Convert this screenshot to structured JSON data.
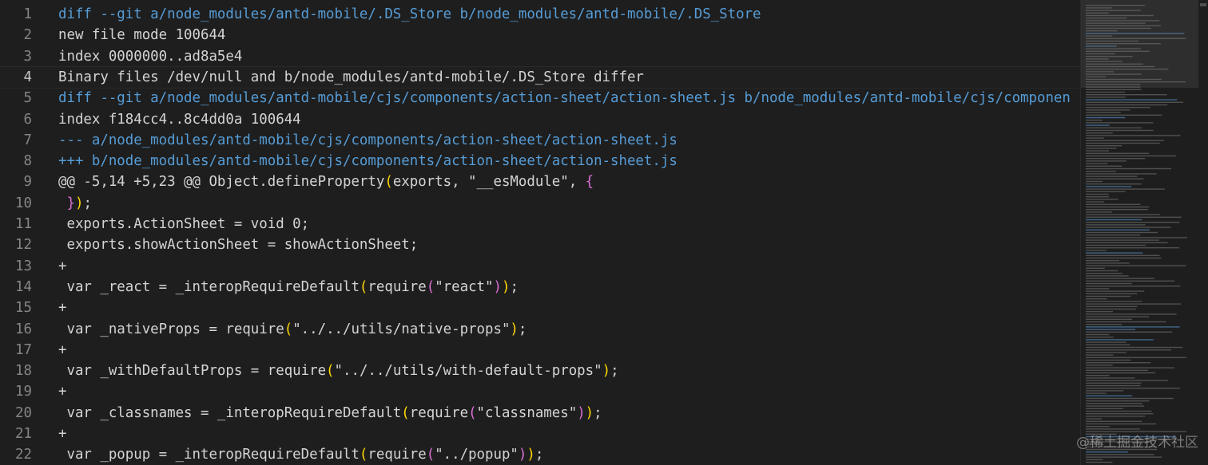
{
  "lines": [
    {
      "num": "1",
      "tokens": [
        {
          "t": "diff --git a/node_modules/antd-mobile/.DS_Store b/node_modules/antd-mobile/.DS_Store",
          "c": "meta"
        }
      ]
    },
    {
      "num": "2",
      "tokens": [
        {
          "t": "new file mode 100644",
          "c": "plain"
        }
      ]
    },
    {
      "num": "3",
      "tokens": [
        {
          "t": "index 0000000..ad8a5e4",
          "c": "plain"
        }
      ]
    },
    {
      "num": "4",
      "active": true,
      "tokens": [
        {
          "t": "Binary files /dev/null and b/node_modules/antd-mobile/.DS_Store differ",
          "c": "plain"
        }
      ]
    },
    {
      "num": "5",
      "tokens": [
        {
          "t": "diff --git a/node_modules/antd-mobile/cjs/components/action-sheet/action-sheet.js b/node_modules/antd-mobile/cjs/componen",
          "c": "meta"
        }
      ]
    },
    {
      "num": "6",
      "tokens": [
        {
          "t": "index f184cc4..8c4dd0a 100644",
          "c": "plain"
        }
      ]
    },
    {
      "num": "7",
      "tokens": [
        {
          "t": "--- a/node_modules/antd-mobile/cjs/components/action-sheet/action-sheet.js",
          "c": "del"
        }
      ]
    },
    {
      "num": "8",
      "tokens": [
        {
          "t": "+++ b/node_modules/antd-mobile/cjs/components/action-sheet/action-sheet.js",
          "c": "meta"
        }
      ]
    },
    {
      "num": "9",
      "tokens": [
        {
          "t": "@@ -5,14 +5,23 @@ Object.defineProperty",
          "c": "plain"
        },
        {
          "t": "(",
          "c": "p1"
        },
        {
          "t": "exports, \"__esModule\", ",
          "c": "plain"
        },
        {
          "t": "{",
          "c": "p2"
        }
      ]
    },
    {
      "num": "10",
      "tokens": [
        {
          "t": " ",
          "c": "plain"
        },
        {
          "t": "}",
          "c": "p2"
        },
        {
          "t": ")",
          "c": "p1"
        },
        {
          "t": ";",
          "c": "plain"
        }
      ]
    },
    {
      "num": "11",
      "tokens": [
        {
          "t": " exports.ActionSheet = void 0;",
          "c": "plain"
        }
      ]
    },
    {
      "num": "12",
      "tokens": [
        {
          "t": " exports.showActionSheet = showActionSheet;",
          "c": "plain"
        }
      ]
    },
    {
      "num": "13",
      "tokens": [
        {
          "t": "+",
          "c": "plain"
        }
      ]
    },
    {
      "num": "14",
      "tokens": [
        {
          "t": " var _react = _interopRequireDefault",
          "c": "plain"
        },
        {
          "t": "(",
          "c": "p1"
        },
        {
          "t": "require",
          "c": "plain"
        },
        {
          "t": "(",
          "c": "p2"
        },
        {
          "t": "\"react\"",
          "c": "plain"
        },
        {
          "t": ")",
          "c": "p2"
        },
        {
          "t": ")",
          "c": "p1"
        },
        {
          "t": ";",
          "c": "plain"
        }
      ]
    },
    {
      "num": "15",
      "tokens": [
        {
          "t": "+",
          "c": "plain"
        }
      ]
    },
    {
      "num": "16",
      "tokens": [
        {
          "t": " var _nativeProps = require",
          "c": "plain"
        },
        {
          "t": "(",
          "c": "p1"
        },
        {
          "t": "\"../../utils/native-props\"",
          "c": "plain"
        },
        {
          "t": ")",
          "c": "p1"
        },
        {
          "t": ";",
          "c": "plain"
        }
      ]
    },
    {
      "num": "17",
      "tokens": [
        {
          "t": "+",
          "c": "plain"
        }
      ]
    },
    {
      "num": "18",
      "tokens": [
        {
          "t": " var _withDefaultProps = require",
          "c": "plain"
        },
        {
          "t": "(",
          "c": "p1"
        },
        {
          "t": "\"../../utils/with-default-props\"",
          "c": "plain"
        },
        {
          "t": ")",
          "c": "p1"
        },
        {
          "t": ";",
          "c": "plain"
        }
      ]
    },
    {
      "num": "19",
      "tokens": [
        {
          "t": "+",
          "c": "plain"
        }
      ]
    },
    {
      "num": "20",
      "tokens": [
        {
          "t": " var _classnames = _interopRequireDefault",
          "c": "plain"
        },
        {
          "t": "(",
          "c": "p1"
        },
        {
          "t": "require",
          "c": "plain"
        },
        {
          "t": "(",
          "c": "p2"
        },
        {
          "t": "\"classnames\"",
          "c": "plain"
        },
        {
          "t": ")",
          "c": "p2"
        },
        {
          "t": ")",
          "c": "p1"
        },
        {
          "t": ";",
          "c": "plain"
        }
      ]
    },
    {
      "num": "21",
      "tokens": [
        {
          "t": "+",
          "c": "plain"
        }
      ]
    },
    {
      "num": "22",
      "tokens": [
        {
          "t": " var _popup = _interopRequireDefault",
          "c": "plain"
        },
        {
          "t": "(",
          "c": "p1"
        },
        {
          "t": "require",
          "c": "plain"
        },
        {
          "t": "(",
          "c": "p2"
        },
        {
          "t": "\"../popup\"",
          "c": "plain"
        },
        {
          "t": ")",
          "c": "p2"
        },
        {
          "t": ")",
          "c": "p1"
        },
        {
          "t": ";",
          "c": "plain"
        }
      ]
    }
  ],
  "watermark": "@稀土掘金技术社区",
  "colors": {
    "background": "#1e1e1e",
    "diff_header": "#569cd6",
    "text": "#d4d4d4",
    "line_number": "#858585",
    "bracket_level_1": "#ffd700",
    "bracket_level_2": "#da70d6"
  }
}
